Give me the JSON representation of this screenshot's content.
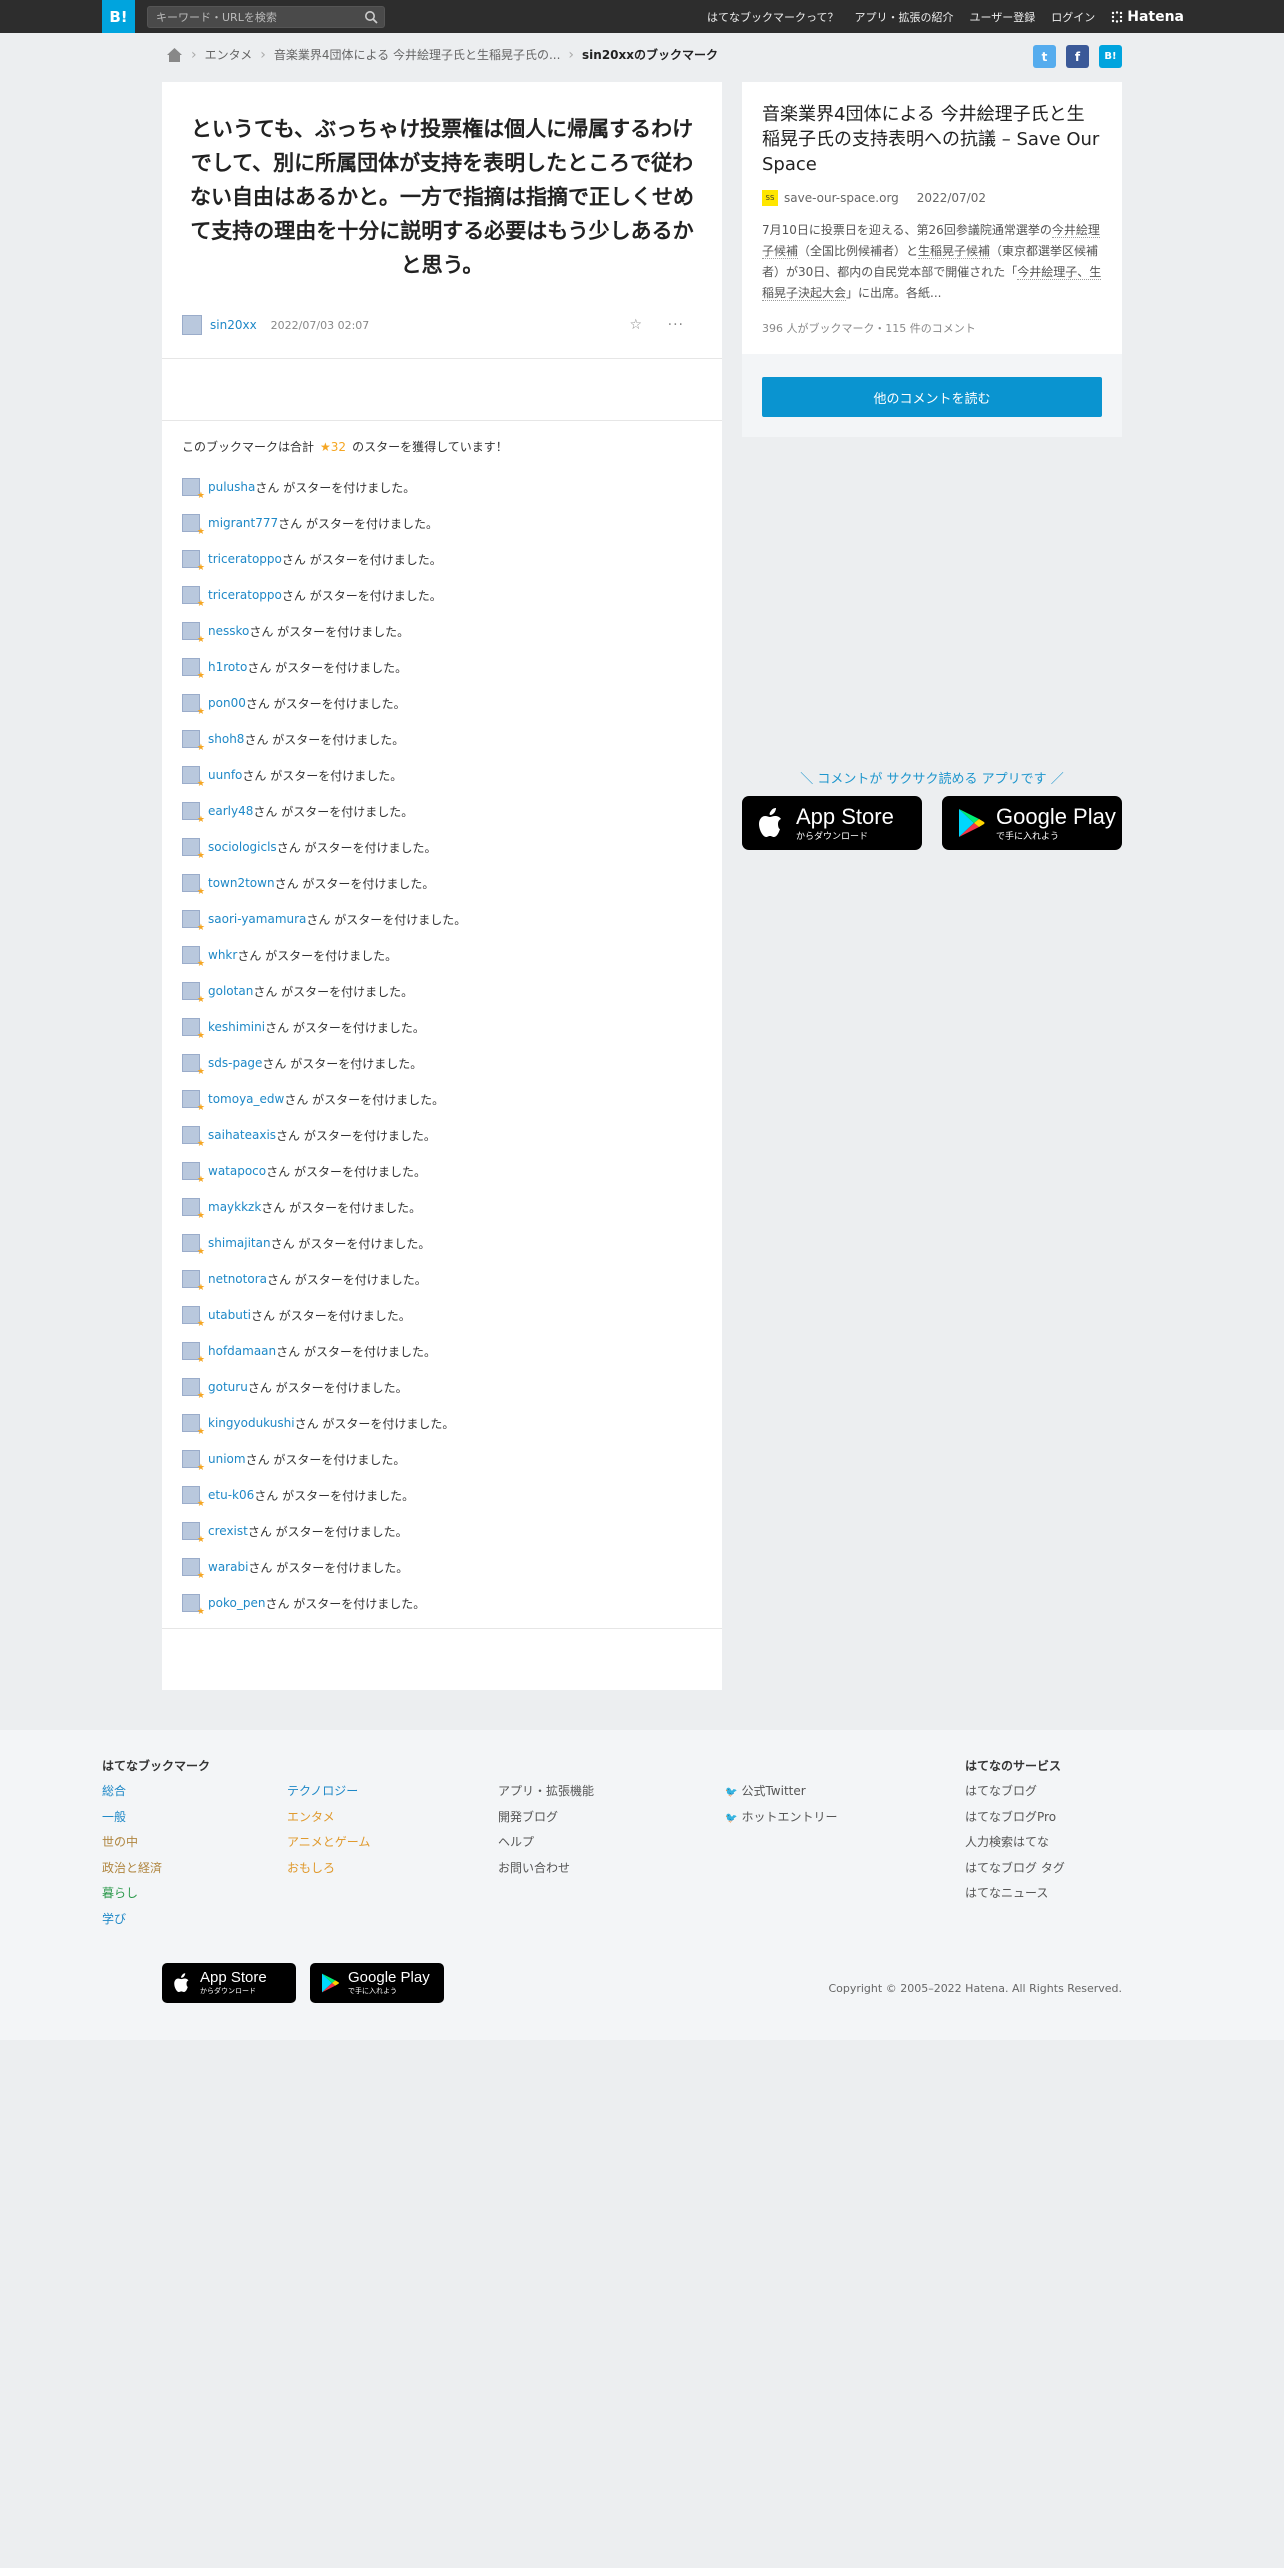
{
  "header": {
    "logo": "B!",
    "search_placeholder": "キーワード・URLを検索",
    "nav": [
      "はてなブックマークって？",
      "アプリ・拡張の紹介",
      "ユーザー登録",
      "ログイン"
    ],
    "brand": "Hatena"
  },
  "breadcrumb": {
    "items": [
      "エンタメ",
      "音楽業界4団体による 今井絵理子氏と生稲晃子氏の..."
    ],
    "current": "sin20xxのブックマーク"
  },
  "share": {
    "twitter": "t",
    "facebook": "f",
    "hatena": "B!"
  },
  "comment": {
    "text": "というても、ぶっちゃけ投票権は個人に帰属するわけでして、別に所属団体が支持を表明したところで従わない自由はあるかと。一方で指摘は指摘で正しくせめて支持の理由を十分に説明する必要はもう少しあるかと思う。",
    "user": "sin20xx",
    "date": "2022/07/03 02:07",
    "more": "···"
  },
  "stars": {
    "summary_prefix": "このブックマークは合計",
    "count": "32",
    "summary_suffix": "のスターを獲得しています！",
    "suffix": "さん がスターを付けました。",
    "users": [
      "pulusha",
      "migrant777",
      "triceratoppo",
      "triceratoppo",
      "nessko",
      "h1roto",
      "pon00",
      "shoh8",
      "uunfo",
      "early48",
      "sociologicls",
      "town2town",
      "saori-yamamura",
      "whkr",
      "golotan",
      "keshimini",
      "sds-page",
      "tomoya_edw",
      "saihateaxis",
      "watapoco",
      "maykkzk",
      "shimajitan",
      "netnotora",
      "utabuti",
      "hofdamaan",
      "goturu",
      "kingyodukushi",
      "uniom",
      "etu-k06",
      "crexist",
      "warabi",
      "poko_pen"
    ]
  },
  "entry": {
    "title": "音楽業界4団体による 今井絵理子氏と生稲晃子氏の支持表明への抗議 – Save Our Space",
    "favicon": "SS",
    "source": "save-our-space.org",
    "date": "2022/07/02",
    "desc_parts": [
      "7月10日に投票日を迎える、第26回参議院通常選挙の",
      "今井絵理子候補",
      "（全国比例候補者）と",
      "生稲晃子候補",
      "（東京都選挙区候補者）が30日、都内の自民党本部で開催された「",
      "今井絵理子、生稲晃子決起大会",
      "」に出席。各紙..."
    ],
    "counts": "396 人がブックマーク・115 件のコメント",
    "more_button": "他のコメントを読む"
  },
  "promo": {
    "text": "＼ コメントが サクサク読める アプリです ／",
    "appstore_small": "からダウンロード",
    "appstore_big": "App Store",
    "googleplay_small": "で手に入れよう",
    "googleplay_big": "Google Play"
  },
  "footer": {
    "heading": "はてなブックマーク",
    "col1": [
      "総合",
      "一般",
      "世の中",
      "政治と経済",
      "暮らし",
      "学び"
    ],
    "col1_colors": [
      "#1e88c7",
      "#1e88c7",
      "#b08640",
      "#b08640",
      "#2e9a4e",
      "#1e88c7"
    ],
    "col2": [
      "テクノロジー",
      "エンタメ",
      "アニメとゲーム",
      "おもしろ"
    ],
    "col2_colors": [
      "#1e88c7",
      "#e09a2e",
      "#e09a2e",
      "#e09a2e"
    ],
    "col3": [
      "アプリ・拡張機能",
      "開発ブログ",
      "ヘルプ",
      "お問い合わせ"
    ],
    "col4": [
      "公式Twitter",
      "ホットエントリー"
    ],
    "services_heading": "はてなのサービス",
    "services": [
      "はてなブログ",
      "はてなブログPro",
      "人力検索はてな",
      "はてなブログ タグ",
      "はてなニュース"
    ],
    "copyright": "Copyright © 2005–2022 Hatena. All Rights Reserved."
  }
}
